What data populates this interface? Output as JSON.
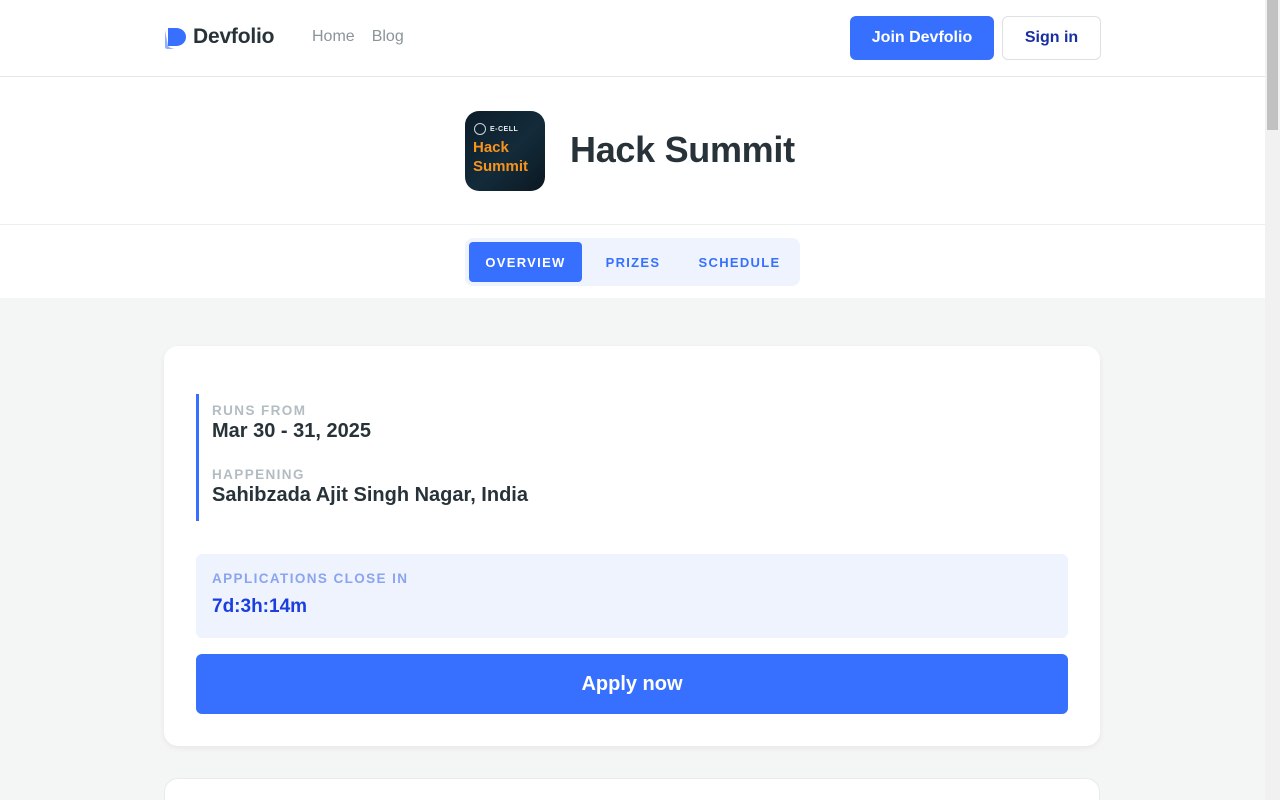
{
  "nav": {
    "brand": "Devfolio",
    "brand_color": "#3770ff",
    "links": [
      "Home",
      "Blog"
    ],
    "join_label": "Join Devfolio",
    "signin_label": "Sign in"
  },
  "hackathon": {
    "logo_text": "Hack Summit",
    "logo_sponsor_text": "E-CELL",
    "logo_text_color": "#f7941d",
    "title": "Hack Summit"
  },
  "tabs": [
    {
      "label": "OVERVIEW",
      "active": true
    },
    {
      "label": "PRIZES",
      "active": false
    },
    {
      "label": "SCHEDULE",
      "active": false
    }
  ],
  "details": {
    "runs_label": "RUNS FROM",
    "runs_value": "Mar 30 - 31, 2025",
    "happening_label": "HAPPENING",
    "happening_value": "Sahibzada Ajit Singh Nagar, India"
  },
  "applications": {
    "close_label": "APPLICATIONS CLOSE IN",
    "countdown": "7d:3h:14m"
  },
  "apply_label": "Apply now",
  "colors": {
    "primary": "#3770ff",
    "primary_light": "#eef3fe",
    "text_dark": "#273339",
    "muted": "#b3bcc1",
    "page_bg": "#f4f5f5"
  },
  "icons": [
    "devfolio-logo-icon",
    "hack-summit-logo"
  ]
}
